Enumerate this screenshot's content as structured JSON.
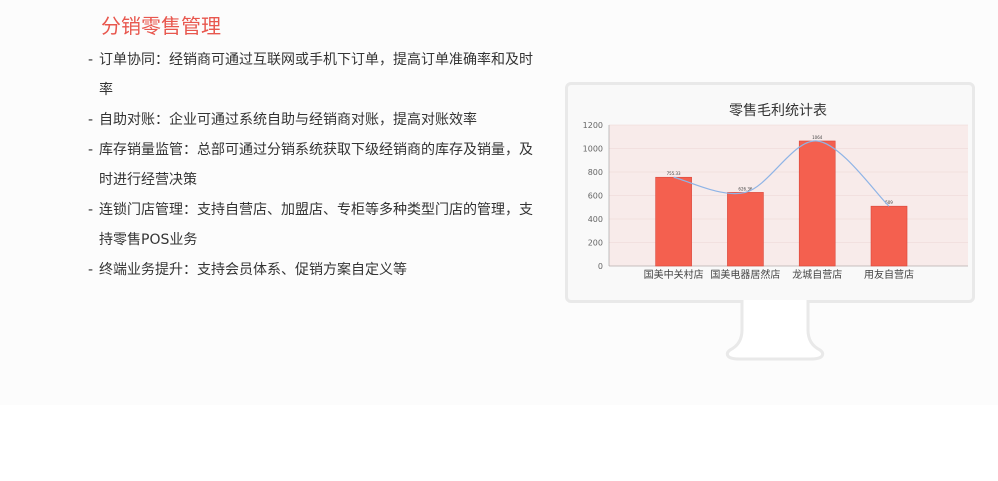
{
  "section": {
    "title": "分销零售管理"
  },
  "features": [
    {
      "dash": "-",
      "text": "订单协同：经销商可通过互联网或手机下订单，提高订单准确率和及时率"
    },
    {
      "dash": "-",
      "text": "自助对账：企业可通过系统自助与经销商对账，提高对账效率"
    },
    {
      "dash": "-",
      "text": "库存销量监管：总部可通过分销系统获取下级经销商的库存及销量，及时进行经营决策"
    },
    {
      "dash": "-",
      "text": "连锁门店管理：支持自营店、加盟店、专柜等多种类型门店的管理，支持零售POS业务"
    },
    {
      "dash": "-",
      "text": "终端业务提升：支持会员体系、促销方案自定义等"
    }
  ],
  "colors": {
    "title": "#e8574e",
    "bar": "#f4604f",
    "line": "#8fb4e6",
    "plot_bg": "#f8ebea",
    "monitor_border": "#e9e9e9"
  },
  "chart_data": {
    "type": "bar",
    "title": "零售毛利统计表",
    "categories": [
      "国美中关村店",
      "国美电器居然店",
      "龙城自营店",
      "用友自营店"
    ],
    "series": [
      {
        "values": [
          755.33,
          626.36,
          1064,
          509
        ]
      }
    ],
    "data_labels": [
      "755.33",
      "626.36",
      "1064",
      "509"
    ],
    "overlay_line": {
      "style": "smooth",
      "values": [
        755.33,
        626.36,
        1064,
        509
      ]
    },
    "ylim": [
      0,
      1200
    ],
    "yticks": [
      "0",
      "200",
      "400",
      "600",
      "800",
      "1000",
      "1200"
    ],
    "xlabel": "",
    "ylabel": "",
    "grid": true
  }
}
